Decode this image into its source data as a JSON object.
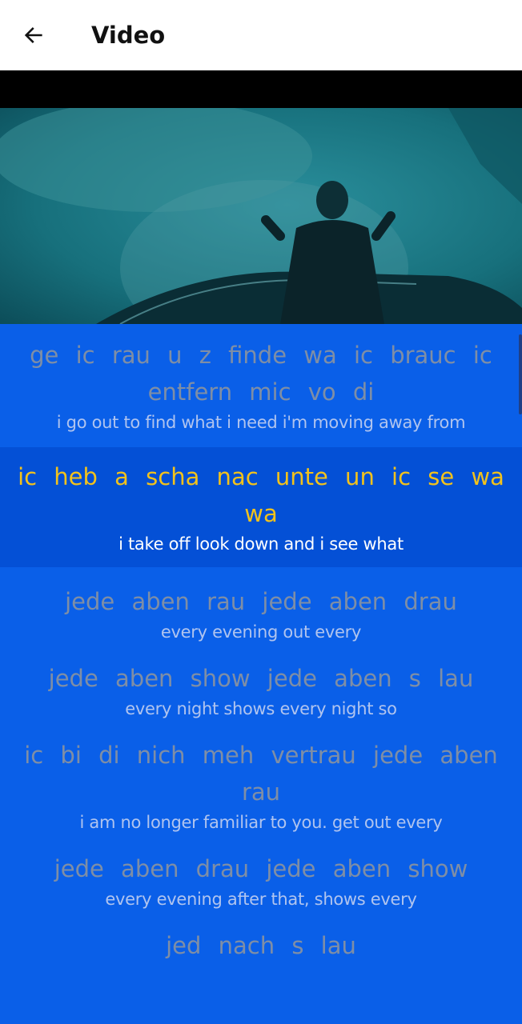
{
  "header": {
    "title": "Video"
  },
  "icons": {
    "back": "arrow-left-icon"
  },
  "colors": {
    "lyrics_background": "#0a5fe8",
    "active_line_background": "#0450d6",
    "active_lyric": "#f2c21c",
    "inactive_lyric": "#7e8ea6",
    "translation": "#b0c4ef"
  },
  "lyrics": [
    {
      "de": "ge ic rau u z finde wa ic brauc ic entfern mic vo di",
      "en": "i go out to find what i need i'm moving away from",
      "active": false
    },
    {
      "de": "ic heb a scha nac unte un ic se wa wa",
      "en": "i take off look down and i see what",
      "active": true
    },
    {
      "de": "jede aben rau jede aben drau",
      "en": "every evening out every",
      "active": false
    },
    {
      "de": "jede aben show jede aben s lau",
      "en": "every night shows every night so",
      "active": false
    },
    {
      "de": "ic bi di nich meh vertrau jede aben rau",
      "en": "i am no longer familiar to you. get out every",
      "active": false
    },
    {
      "de": "jede aben drau jede aben show",
      "en": "every evening after that, shows every",
      "active": false
    },
    {
      "de": "jed nach s lau",
      "en": "",
      "active": false
    }
  ]
}
